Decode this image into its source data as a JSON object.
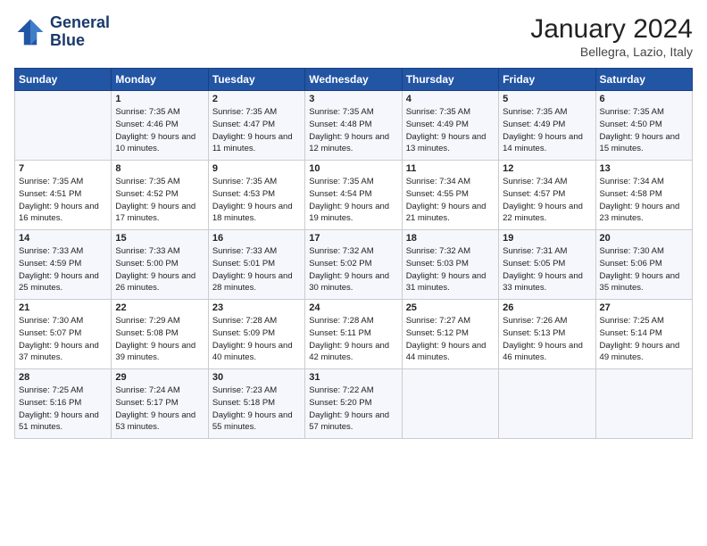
{
  "logo": {
    "line1": "General",
    "line2": "Blue"
  },
  "title": "January 2024",
  "location": "Bellegra, Lazio, Italy",
  "headers": [
    "Sunday",
    "Monday",
    "Tuesday",
    "Wednesday",
    "Thursday",
    "Friday",
    "Saturday"
  ],
  "weeks": [
    [
      {
        "day": "",
        "sunrise": "",
        "sunset": "",
        "daylight": ""
      },
      {
        "day": "1",
        "sunrise": "Sunrise: 7:35 AM",
        "sunset": "Sunset: 4:46 PM",
        "daylight": "Daylight: 9 hours and 10 minutes."
      },
      {
        "day": "2",
        "sunrise": "Sunrise: 7:35 AM",
        "sunset": "Sunset: 4:47 PM",
        "daylight": "Daylight: 9 hours and 11 minutes."
      },
      {
        "day": "3",
        "sunrise": "Sunrise: 7:35 AM",
        "sunset": "Sunset: 4:48 PM",
        "daylight": "Daylight: 9 hours and 12 minutes."
      },
      {
        "day": "4",
        "sunrise": "Sunrise: 7:35 AM",
        "sunset": "Sunset: 4:49 PM",
        "daylight": "Daylight: 9 hours and 13 minutes."
      },
      {
        "day": "5",
        "sunrise": "Sunrise: 7:35 AM",
        "sunset": "Sunset: 4:49 PM",
        "daylight": "Daylight: 9 hours and 14 minutes."
      },
      {
        "day": "6",
        "sunrise": "Sunrise: 7:35 AM",
        "sunset": "Sunset: 4:50 PM",
        "daylight": "Daylight: 9 hours and 15 minutes."
      }
    ],
    [
      {
        "day": "7",
        "sunrise": "Sunrise: 7:35 AM",
        "sunset": "Sunset: 4:51 PM",
        "daylight": "Daylight: 9 hours and 16 minutes."
      },
      {
        "day": "8",
        "sunrise": "Sunrise: 7:35 AM",
        "sunset": "Sunset: 4:52 PM",
        "daylight": "Daylight: 9 hours and 17 minutes."
      },
      {
        "day": "9",
        "sunrise": "Sunrise: 7:35 AM",
        "sunset": "Sunset: 4:53 PM",
        "daylight": "Daylight: 9 hours and 18 minutes."
      },
      {
        "day": "10",
        "sunrise": "Sunrise: 7:35 AM",
        "sunset": "Sunset: 4:54 PM",
        "daylight": "Daylight: 9 hours and 19 minutes."
      },
      {
        "day": "11",
        "sunrise": "Sunrise: 7:34 AM",
        "sunset": "Sunset: 4:55 PM",
        "daylight": "Daylight: 9 hours and 21 minutes."
      },
      {
        "day": "12",
        "sunrise": "Sunrise: 7:34 AM",
        "sunset": "Sunset: 4:57 PM",
        "daylight": "Daylight: 9 hours and 22 minutes."
      },
      {
        "day": "13",
        "sunrise": "Sunrise: 7:34 AM",
        "sunset": "Sunset: 4:58 PM",
        "daylight": "Daylight: 9 hours and 23 minutes."
      }
    ],
    [
      {
        "day": "14",
        "sunrise": "Sunrise: 7:33 AM",
        "sunset": "Sunset: 4:59 PM",
        "daylight": "Daylight: 9 hours and 25 minutes."
      },
      {
        "day": "15",
        "sunrise": "Sunrise: 7:33 AM",
        "sunset": "Sunset: 5:00 PM",
        "daylight": "Daylight: 9 hours and 26 minutes."
      },
      {
        "day": "16",
        "sunrise": "Sunrise: 7:33 AM",
        "sunset": "Sunset: 5:01 PM",
        "daylight": "Daylight: 9 hours and 28 minutes."
      },
      {
        "day": "17",
        "sunrise": "Sunrise: 7:32 AM",
        "sunset": "Sunset: 5:02 PM",
        "daylight": "Daylight: 9 hours and 30 minutes."
      },
      {
        "day": "18",
        "sunrise": "Sunrise: 7:32 AM",
        "sunset": "Sunset: 5:03 PM",
        "daylight": "Daylight: 9 hours and 31 minutes."
      },
      {
        "day": "19",
        "sunrise": "Sunrise: 7:31 AM",
        "sunset": "Sunset: 5:05 PM",
        "daylight": "Daylight: 9 hours and 33 minutes."
      },
      {
        "day": "20",
        "sunrise": "Sunrise: 7:30 AM",
        "sunset": "Sunset: 5:06 PM",
        "daylight": "Daylight: 9 hours and 35 minutes."
      }
    ],
    [
      {
        "day": "21",
        "sunrise": "Sunrise: 7:30 AM",
        "sunset": "Sunset: 5:07 PM",
        "daylight": "Daylight: 9 hours and 37 minutes."
      },
      {
        "day": "22",
        "sunrise": "Sunrise: 7:29 AM",
        "sunset": "Sunset: 5:08 PM",
        "daylight": "Daylight: 9 hours and 39 minutes."
      },
      {
        "day": "23",
        "sunrise": "Sunrise: 7:28 AM",
        "sunset": "Sunset: 5:09 PM",
        "daylight": "Daylight: 9 hours and 40 minutes."
      },
      {
        "day": "24",
        "sunrise": "Sunrise: 7:28 AM",
        "sunset": "Sunset: 5:11 PM",
        "daylight": "Daylight: 9 hours and 42 minutes."
      },
      {
        "day": "25",
        "sunrise": "Sunrise: 7:27 AM",
        "sunset": "Sunset: 5:12 PM",
        "daylight": "Daylight: 9 hours and 44 minutes."
      },
      {
        "day": "26",
        "sunrise": "Sunrise: 7:26 AM",
        "sunset": "Sunset: 5:13 PM",
        "daylight": "Daylight: 9 hours and 46 minutes."
      },
      {
        "day": "27",
        "sunrise": "Sunrise: 7:25 AM",
        "sunset": "Sunset: 5:14 PM",
        "daylight": "Daylight: 9 hours and 49 minutes."
      }
    ],
    [
      {
        "day": "28",
        "sunrise": "Sunrise: 7:25 AM",
        "sunset": "Sunset: 5:16 PM",
        "daylight": "Daylight: 9 hours and 51 minutes."
      },
      {
        "day": "29",
        "sunrise": "Sunrise: 7:24 AM",
        "sunset": "Sunset: 5:17 PM",
        "daylight": "Daylight: 9 hours and 53 minutes."
      },
      {
        "day": "30",
        "sunrise": "Sunrise: 7:23 AM",
        "sunset": "Sunset: 5:18 PM",
        "daylight": "Daylight: 9 hours and 55 minutes."
      },
      {
        "day": "31",
        "sunrise": "Sunrise: 7:22 AM",
        "sunset": "Sunset: 5:20 PM",
        "daylight": "Daylight: 9 hours and 57 minutes."
      },
      {
        "day": "",
        "sunrise": "",
        "sunset": "",
        "daylight": ""
      },
      {
        "day": "",
        "sunrise": "",
        "sunset": "",
        "daylight": ""
      },
      {
        "day": "",
        "sunrise": "",
        "sunset": "",
        "daylight": ""
      }
    ]
  ]
}
